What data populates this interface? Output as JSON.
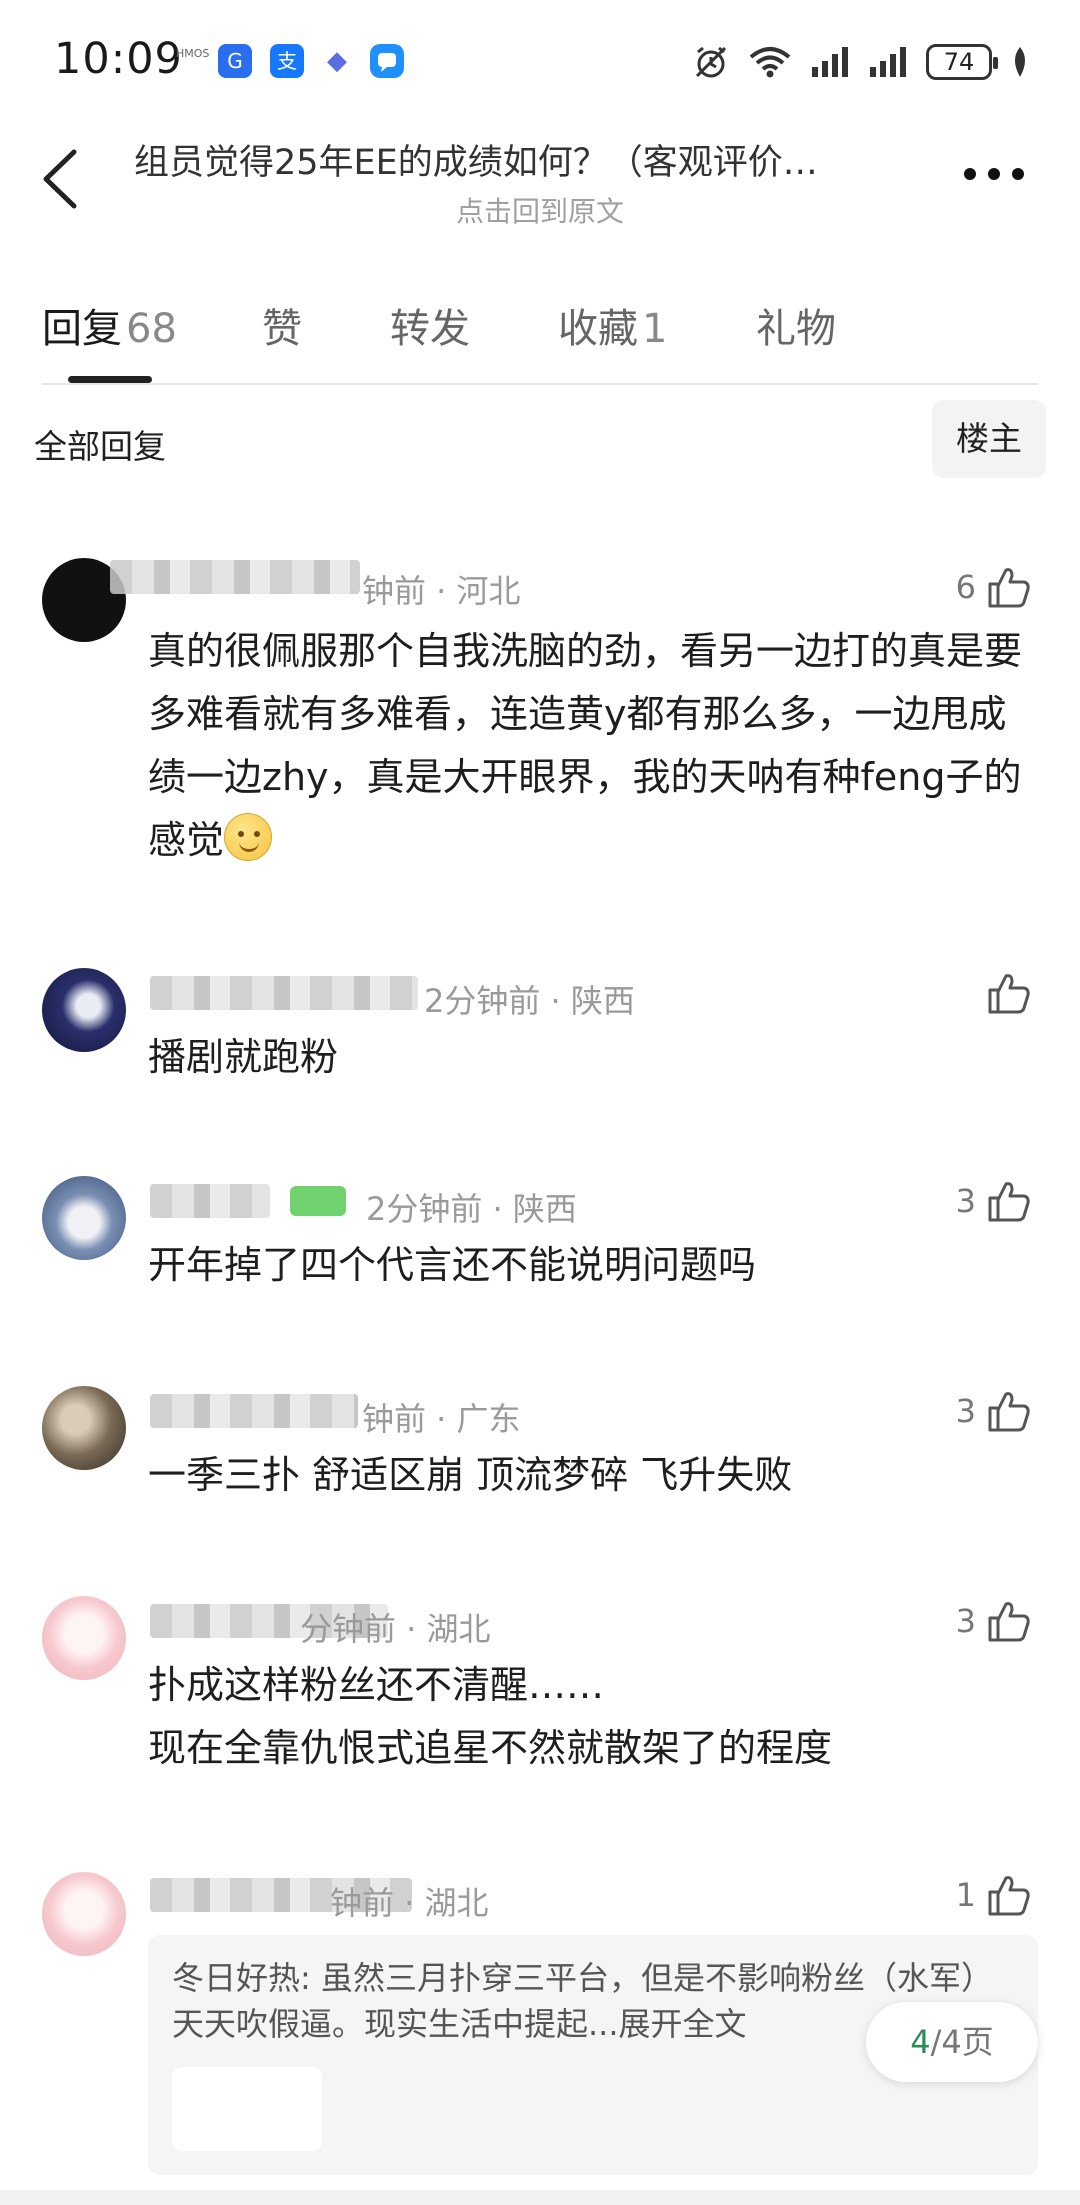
{
  "status_bar": {
    "time": "10:09",
    "hmos": "HMOS",
    "battery": "74",
    "apps": [
      {
        "icon": "app-blue-icon",
        "color": "#2a6ef0",
        "glyph": "G"
      },
      {
        "icon": "alipay-icon",
        "color": "#1677ff",
        "glyph": "支"
      },
      {
        "icon": "app-drop-icon",
        "color": "#5b6ee1",
        "glyph": "◆"
      },
      {
        "icon": "chat-icon",
        "color": "#1e90ff",
        "glyph": "▭"
      }
    ]
  },
  "header": {
    "title": "组员觉得25年EE的成绩如何？（客观评价…",
    "subtitle": "点击回到原文"
  },
  "tabs": [
    {
      "label": "回复",
      "count": "68"
    },
    {
      "label": "赞",
      "count": ""
    },
    {
      "label": "转发",
      "count": ""
    },
    {
      "label": "收藏",
      "count": "1"
    },
    {
      "label": "礼物",
      "count": ""
    }
  ],
  "filter": {
    "all_label": "全部回复",
    "louzhu_label": "楼主"
  },
  "comments": [
    {
      "meta": "钟前 · 河北",
      "likes": "6",
      "text": "真的很佩服那个自我洗脑的劲，看另一边打的真是要多难看就有多难看，连造黄y都有那么多，一边甩成绩一边zhy，真是大开眼界，我的天呐有种feng子的感觉"
    },
    {
      "meta": "2分钟前 · 陕西",
      "likes": "",
      "text": "播剧就跑粉"
    },
    {
      "meta": "2分钟前 · 陕西",
      "likes": "3",
      "text": "开年掉了四个代言还不能说明问题吗"
    },
    {
      "meta": "钟前 · 广东",
      "likes": "3",
      "text": "一季三扑 舒适区崩 顶流梦碎 飞升失败"
    },
    {
      "meta": "分钟前 · 湖北",
      "likes": "3",
      "text_line1": "扑成这样粉丝还不清醒……",
      "text_line2": "现在全靠仇恨式追星不然就散架了的程度"
    },
    {
      "meta": "钟前 · 湖北",
      "likes": "1"
    }
  ],
  "sub_reply": {
    "name": "冬日好热:",
    "text": "虽然三月扑穿三平台，但是不影响粉丝（水军）天天吹假逼。现实生活中提起...",
    "expand": "展开全文"
  },
  "pager": {
    "current": "4",
    "total": "/4页"
  }
}
